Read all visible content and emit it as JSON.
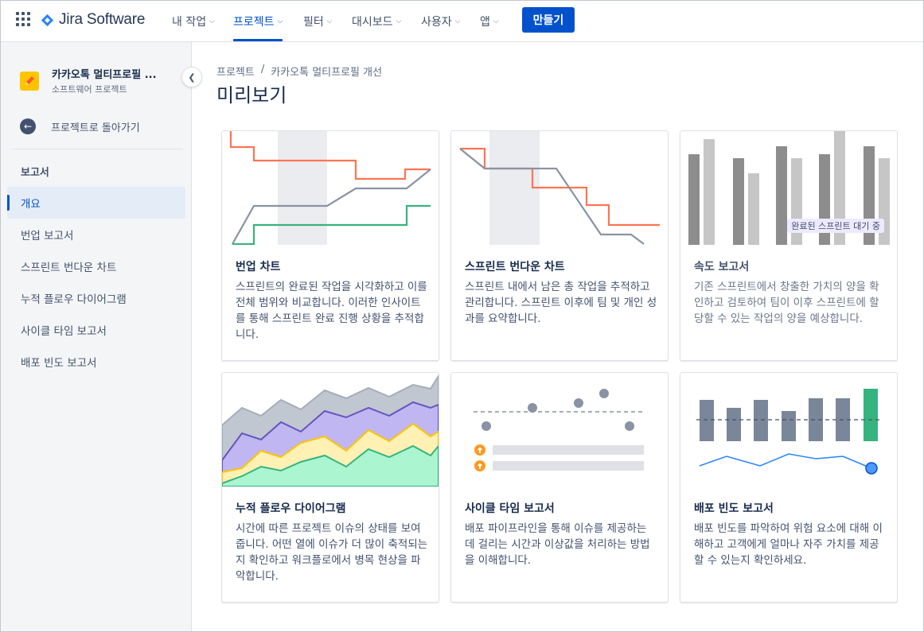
{
  "topnav": {
    "logo_text": "Jira Software",
    "items": [
      {
        "label": "내 작업"
      },
      {
        "label": "프로젝트"
      },
      {
        "label": "필터"
      },
      {
        "label": "대시보드"
      },
      {
        "label": "사용자"
      },
      {
        "label": "앱"
      }
    ],
    "create_label": "만들기",
    "colors": {
      "accent": "#0052cc"
    }
  },
  "sidebar": {
    "project_name": "카카오톡 멀티프로필 ...",
    "project_type": "소프트웨어 프로젝트",
    "back_label": "프로젝트로 돌아가기",
    "section_label": "보고서",
    "items": [
      {
        "label": "개요",
        "active": true
      },
      {
        "label": "번업 보고서"
      },
      {
        "label": "스프린트 번다운 차트"
      },
      {
        "label": "누적 플로우 다이어그램"
      },
      {
        "label": "사이클 타임 보고서"
      },
      {
        "label": "배포 빈도 보고서"
      }
    ]
  },
  "breadcrumb": {
    "items": [
      {
        "label": "프로젝트"
      },
      {
        "label": "카카오톡 멀티프로필 개선"
      }
    ],
    "separator": "/"
  },
  "page_title": "미리보기",
  "cards": [
    {
      "title": "번업 차트",
      "desc": "스프린트의 완료된 작업을 시각화하고 이를 전체 범위와 비교합니다. 이러한 인사이트를 통해 스프린트 완료 진행 상황을 추적합니다.",
      "icon": "burnup-chart-illustration"
    },
    {
      "title": "스프린트 번다운 차트",
      "desc": "스프린트 내에서 남은 총 작업을 추적하고 관리합니다. 스프린트 이후에 팀 및 개인 성과를 요약합니다.",
      "icon": "burndown-chart-illustration"
    },
    {
      "title": "속도 보고서",
      "desc": "기존 스프린트에서 창출한 가치의 양을 확인하고 검토하여 팀이 이후 스프린트에 할당할 수 있는 작업의 양을 예상합니다.",
      "badge": "완료된 스프린트 대기 중",
      "icon": "velocity-chart-illustration"
    },
    {
      "title": "누적 플로우 다이어그램",
      "desc": "시간에 따른 프로젝트 이슈의 상태를 보여줍니다. 어떤 열에 이슈가 더 많이 축적되는지 확인하고 워크플로에서 병목 현상을 파악합니다.",
      "icon": "cumulative-flow-illustration"
    },
    {
      "title": "사이클 타임 보고서",
      "desc": "배포 파이프라인을 통해 이슈를 제공하는 데 걸리는 시간과 이상값을 처리하는 방법을 이해합니다.",
      "icon": "cycle-time-illustration"
    },
    {
      "title": "배포 빈도 보고서",
      "desc": "배포 빈도를 파악하여 위험 요소에 대해 이해하고 고객에게 얼마나 자주 가치를 제공할 수 있는지 확인하세요.",
      "icon": "deployment-frequency-illustration"
    }
  ]
}
